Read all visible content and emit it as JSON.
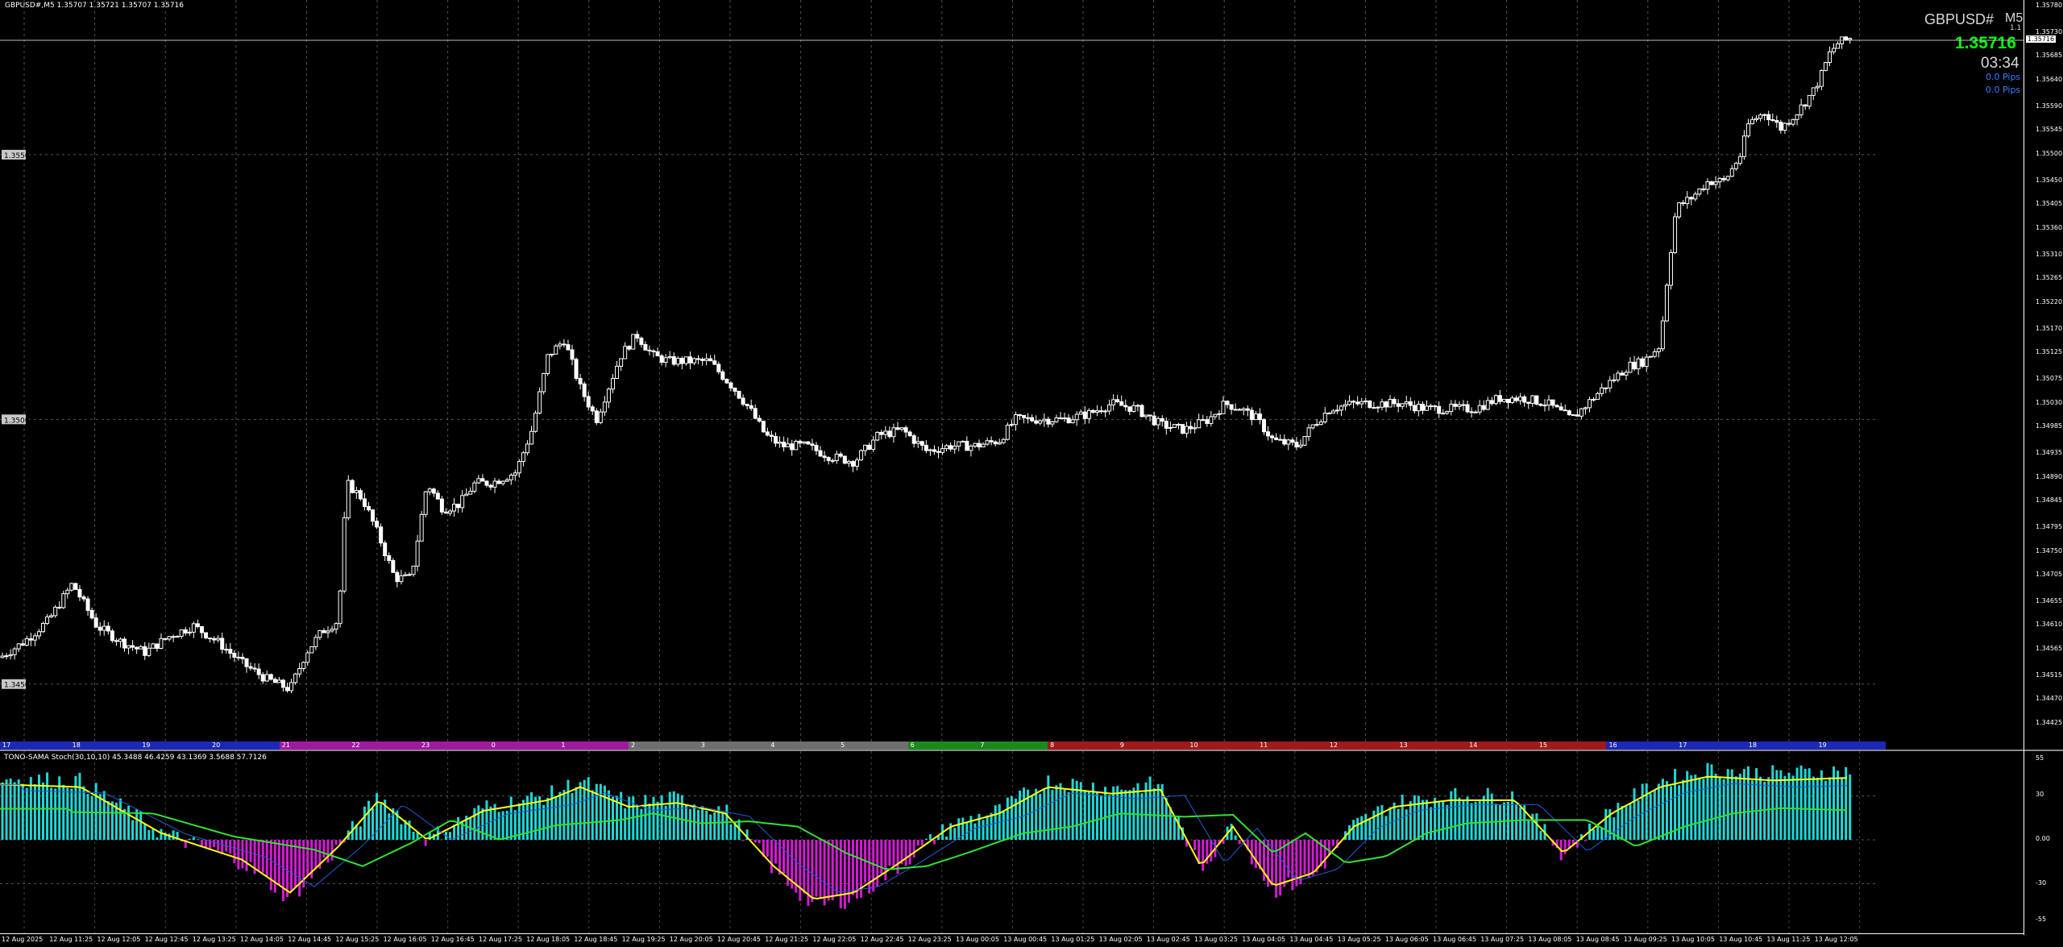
{
  "header": {
    "title": "GBPUSD#,M5  1.35707 1.35721 1.35707 1.35716",
    "symbol": "GBPUSD#",
    "timeframe": "M5",
    "sub": "1.1",
    "price": "1.35716",
    "timer": "03:34",
    "pips1": "0.0 Pips",
    "pips2": "0.0 Pips"
  },
  "colors": {
    "background": "#000000",
    "bull": "#ffffff",
    "bear": "#ffffff",
    "price_accent": "#00ff00",
    "histogram_pos": "#20d7d7",
    "histogram_neg": "#d61ad6",
    "line_yellow": "#ffff00",
    "line_green": "#33e033",
    "line_blue": "#1e5fd6"
  },
  "price_axis": {
    "ticks": [
      "1.35780",
      "1.35730",
      "1.35685",
      "1.35640",
      "1.35590",
      "1.35545",
      "1.35500",
      "1.35450",
      "1.35405",
      "1.35360",
      "1.35310",
      "1.35265",
      "1.35220",
      "1.35170",
      "1.35125",
      "1.35075",
      "1.35030",
      "1.34985",
      "1.34935",
      "1.34890",
      "1.34845",
      "1.34795",
      "1.34750",
      "1.34705",
      "1.34655",
      "1.34610",
      "1.34565",
      "1.34515",
      "1.34470",
      "1.34425"
    ],
    "range": [
      1.34425,
      1.3578
    ],
    "current_label": "1.35716",
    "left_labels": [
      "1.3550",
      "1.3500",
      "1.3450"
    ]
  },
  "sessions": [
    {
      "label": "17",
      "color": "#1c28b8"
    },
    {
      "label": "18",
      "color": "#1c28b8"
    },
    {
      "label": "19",
      "color": "#1c28b8"
    },
    {
      "label": "20",
      "color": "#1c28b8"
    },
    {
      "label": "21",
      "color": "#a01aa0"
    },
    {
      "label": "22",
      "color": "#a01aa0"
    },
    {
      "label": "23",
      "color": "#a01aa0"
    },
    {
      "label": "0",
      "color": "#a01aa0"
    },
    {
      "label": "1",
      "color": "#a01aa0"
    },
    {
      "label": "2",
      "color": "#6e6e6e"
    },
    {
      "label": "3",
      "color": "#6e6e6e"
    },
    {
      "label": "4",
      "color": "#6e6e6e"
    },
    {
      "label": "5",
      "color": "#6e6e6e"
    },
    {
      "label": "6",
      "color": "#1a8a1a"
    },
    {
      "label": "7",
      "color": "#1a8a1a"
    },
    {
      "label": "8",
      "color": "#a01a1a"
    },
    {
      "label": "9",
      "color": "#a01a1a"
    },
    {
      "label": "10",
      "color": "#a01a1a"
    },
    {
      "label": "11",
      "color": "#a01a1a"
    },
    {
      "label": "12",
      "color": "#a01a1a"
    },
    {
      "label": "13",
      "color": "#a01a1a"
    },
    {
      "label": "14",
      "color": "#a01a1a"
    },
    {
      "label": "15",
      "color": "#a01a1a"
    },
    {
      "label": "16",
      "color": "#1c28b8"
    },
    {
      "label": "17",
      "color": "#1c28b8"
    },
    {
      "label": "18",
      "color": "#1c28b8"
    },
    {
      "label": "19",
      "color": "#1c28b8"
    }
  ],
  "indicator": {
    "title": "TONO-SAMA Stoch(30,10,10) 45.3488 46.4259 43.1369 3.5688 57.7126",
    "axis_ticks": [
      "55",
      "30",
      "0.00",
      "-30",
      "-55"
    ],
    "range": [
      -55,
      55
    ]
  },
  "time_axis": [
    "12 Aug 2025",
    "12 Aug 11:25",
    "12 Aug 12:05",
    "12 Aug 12:45",
    "12 Aug 13:25",
    "12 Aug 14:05",
    "12 Aug 14:45",
    "12 Aug 15:25",
    "12 Aug 16:05",
    "12 Aug 16:45",
    "12 Aug 17:25",
    "12 Aug 18:05",
    "12 Aug 18:45",
    "12 Aug 19:25",
    "12 Aug 20:05",
    "12 Aug 20:45",
    "12 Aug 21:25",
    "12 Aug 22:05",
    "12 Aug 22:45",
    "12 Aug 23:25",
    "13 Aug 00:05",
    "13 Aug 00:45",
    "13 Aug 01:25",
    "13 Aug 02:05",
    "13 Aug 02:45",
    "13 Aug 03:25",
    "13 Aug 04:05",
    "13 Aug 04:45",
    "13 Aug 05:25",
    "13 Aug 06:05",
    "13 Aug 06:45",
    "13 Aug 07:25",
    "13 Aug 08:05",
    "13 Aug 08:45",
    "13 Aug 09:25",
    "13 Aug 10:05",
    "13 Aug 10:45",
    "13 Aug 11:25",
    "13 Aug 12:05"
  ],
  "chart_data": {
    "type": "candlestick",
    "price_path": [
      [
        0,
        1.3455
      ],
      [
        30,
        1.3458
      ],
      [
        60,
        1.3462
      ],
      [
        90,
        1.3469
      ],
      [
        120,
        1.3461
      ],
      [
        150,
        1.3458
      ],
      [
        180,
        1.3456
      ],
      [
        210,
        1.3459
      ],
      [
        240,
        1.3461
      ],
      [
        270,
        1.3458
      ],
      [
        300,
        1.3454
      ],
      [
        330,
        1.3451
      ],
      [
        360,
        1.3449
      ],
      [
        380,
        1.3456
      ],
      [
        400,
        1.346
      ],
      [
        420,
        1.3462
      ],
      [
        430,
        1.3488
      ],
      [
        450,
        1.3485
      ],
      [
        470,
        1.3478
      ],
      [
        490,
        1.347
      ],
      [
        510,
        1.347
      ],
      [
        530,
        1.3488
      ],
      [
        550,
        1.3483
      ],
      [
        570,
        1.3484
      ],
      [
        590,
        1.3488
      ],
      [
        610,
        1.3488
      ],
      [
        640,
        1.349
      ],
      [
        660,
        1.3498
      ],
      [
        680,
        1.3512
      ],
      [
        700,
        1.3515
      ],
      [
        720,
        1.3506
      ],
      [
        740,
        1.35
      ],
      [
        770,
        1.3512
      ],
      [
        790,
        1.3516
      ],
      [
        810,
        1.3512
      ],
      [
        830,
        1.3511
      ],
      [
        850,
        1.3511
      ],
      [
        880,
        1.3511
      ],
      [
        910,
        1.3506
      ],
      [
        930,
        1.3502
      ],
      [
        950,
        1.3497
      ],
      [
        970,
        1.3495
      ],
      [
        1000,
        1.3495
      ],
      [
        1030,
        1.3493
      ],
      [
        1060,
        1.3492
      ],
      [
        1090,
        1.3497
      ],
      [
        1120,
        1.3498
      ],
      [
        1150,
        1.3494
      ],
      [
        1180,
        1.3495
      ],
      [
        1210,
        1.3495
      ],
      [
        1240,
        1.3496
      ],
      [
        1260,
        1.35
      ],
      [
        1290,
        1.35
      ],
      [
        1320,
        1.35
      ],
      [
        1350,
        1.3501
      ],
      [
        1380,
        1.3503
      ],
      [
        1410,
        1.3502
      ],
      [
        1440,
        1.3499
      ],
      [
        1470,
        1.3498
      ],
      [
        1500,
        1.35
      ],
      [
        1520,
        1.3503
      ],
      [
        1540,
        1.3502
      ],
      [
        1560,
        1.35
      ],
      [
        1580,
        1.3496
      ],
      [
        1610,
        1.3495
      ],
      [
        1630,
        1.3499
      ],
      [
        1650,
        1.3502
      ],
      [
        1680,
        1.3503
      ],
      [
        1710,
        1.3503
      ],
      [
        1740,
        1.3503
      ],
      [
        1770,
        1.3502
      ],
      [
        1800,
        1.3502
      ],
      [
        1830,
        1.3502
      ],
      [
        1860,
        1.3504
      ],
      [
        1890,
        1.3504
      ],
      [
        1920,
        1.3503
      ],
      [
        1950,
        1.35
      ],
      [
        1970,
        1.3503
      ],
      [
        1990,
        1.3506
      ],
      [
        2020,
        1.351
      ],
      [
        2040,
        1.3511
      ],
      [
        2060,
        1.3514
      ],
      [
        2070,
        1.3528
      ],
      [
        2080,
        1.354
      ],
      [
        2100,
        1.3542
      ],
      [
        2120,
        1.3545
      ],
      [
        2140,
        1.3545
      ],
      [
        2160,
        1.355
      ],
      [
        2170,
        1.3556
      ],
      [
        2190,
        1.3558
      ],
      [
        2210,
        1.3555
      ],
      [
        2230,
        1.3558
      ],
      [
        2250,
        1.3562
      ],
      [
        2260,
        1.3565
      ],
      [
        2270,
        1.3569
      ],
      [
        2280,
        1.3571
      ],
      [
        2296,
        1.3572
      ]
    ],
    "last_price": 1.35716
  }
}
